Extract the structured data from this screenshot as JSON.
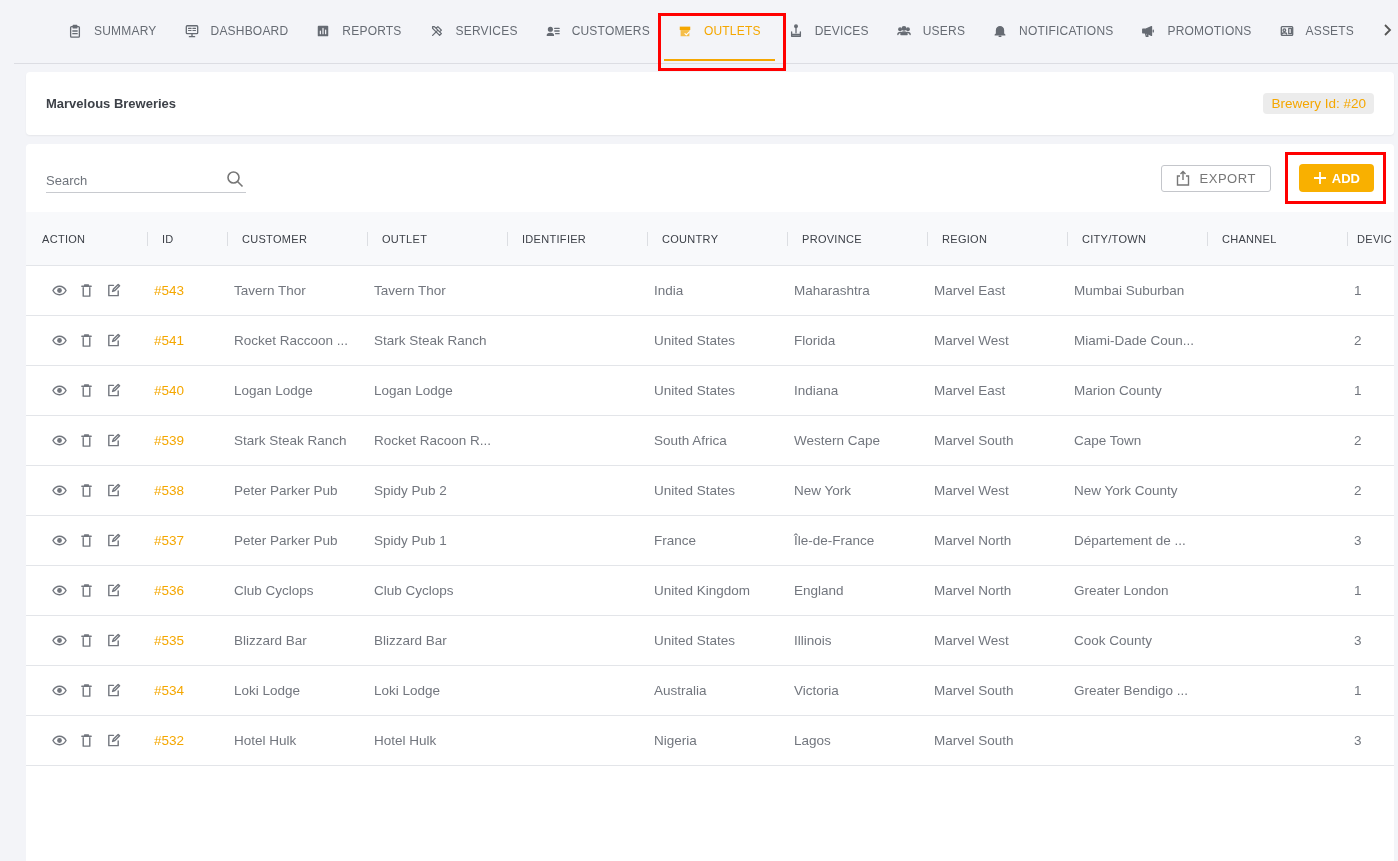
{
  "nav": {
    "tabs": [
      {
        "label": "SUMMARY",
        "selected": false,
        "highlighted": false
      },
      {
        "label": "DASHBOARD",
        "selected": false,
        "highlighted": false
      },
      {
        "label": "REPORTS",
        "selected": false,
        "highlighted": false
      },
      {
        "label": "SERVICES",
        "selected": false,
        "highlighted": false
      },
      {
        "label": "CUSTOMERS",
        "selected": false,
        "highlighted": false
      },
      {
        "label": "OUTLETS",
        "selected": true,
        "highlighted": true
      },
      {
        "label": "DEVICES",
        "selected": false,
        "highlighted": false
      },
      {
        "label": "USERS",
        "selected": false,
        "highlighted": false
      },
      {
        "label": "NOTIFICATIONS",
        "selected": false,
        "highlighted": false
      },
      {
        "label": "PROMOTIONS",
        "selected": false,
        "highlighted": false
      },
      {
        "label": "ASSETS",
        "selected": false,
        "highlighted": false
      }
    ]
  },
  "brewery": {
    "name": "Marvelous Breweries",
    "badge": "Brewery Id: #20"
  },
  "toolbar": {
    "search": {
      "placeholder": "Search"
    },
    "export_button": {
      "label": "EXPORT"
    },
    "add_button": {
      "label": "ADD",
      "highlighted": true
    }
  },
  "table": {
    "columns": [
      "ACTION",
      "ID",
      "CUSTOMER",
      "OUTLET",
      "IDENTIFIER",
      "COUNTRY",
      "PROVINCE",
      "REGION",
      "CITY/TOWN",
      "CHANNEL",
      "DEVIC"
    ],
    "rows": [
      {
        "id": "#543",
        "customer": "Tavern Thor",
        "outlet": "Tavern Thor",
        "country": "India",
        "province": "Maharashtra",
        "region": "Marvel East",
        "city_town": "Mumbai Suburban",
        "column_11": "1"
      },
      {
        "id": "#541",
        "customer": "Rocket Raccoon ...",
        "outlet": "Stark Steak Ranch",
        "country": "United States",
        "province": "Florida",
        "region": "Marvel West",
        "city_town": "Miami-Dade Coun...",
        "column_11": "2"
      },
      {
        "id": "#540",
        "customer": "Logan Lodge",
        "outlet": "Logan Lodge",
        "country": "United States",
        "province": "Indiana",
        "region": "Marvel East",
        "city_town": "Marion County",
        "column_11": "1"
      },
      {
        "id": "#539",
        "customer": "Stark Steak Ranch",
        "outlet": "Rocket Racoon R...",
        "country": "South Africa",
        "province": "Western Cape",
        "region": "Marvel South",
        "city_town": "Cape Town",
        "column_11": "2"
      },
      {
        "id": "#538",
        "customer": "Peter Parker Pub",
        "outlet": "Spidy Pub 2",
        "country": "United States",
        "province": "New York",
        "region": "Marvel West",
        "city_town": "New York County",
        "column_11": "2"
      },
      {
        "id": "#537",
        "customer": "Peter Parker Pub",
        "outlet": "Spidy Pub 1",
        "country": "France",
        "province": "Île-de-France",
        "region": "Marvel North",
        "city_town": "Département de ...",
        "column_11": "3"
      },
      {
        "id": "#536",
        "customer": "Club Cyclops",
        "outlet": "Club Cyclops",
        "country": "United Kingdom",
        "province": "England",
        "region": "Marvel North",
        "city_town": "Greater London",
        "column_11": "1"
      },
      {
        "id": "#535",
        "customer": "Blizzard Bar",
        "outlet": "Blizzard Bar",
        "country": "United States",
        "province": "Illinois",
        "region": "Marvel West",
        "city_town": "Cook County",
        "column_11": "3"
      },
      {
        "id": "#534",
        "customer": "Loki Lodge",
        "outlet": "Loki Lodge",
        "country": "Australia",
        "province": "Victoria",
        "region": "Marvel South",
        "city_town": "Greater Bendigo ...",
        "column_11": "1"
      },
      {
        "id": "#532",
        "customer": "Hotel Hulk",
        "outlet": "Hotel Hulk",
        "country": "Nigeria",
        "province": "Lagos",
        "region": "Marvel South",
        "column_11": "3"
      }
    ]
  }
}
